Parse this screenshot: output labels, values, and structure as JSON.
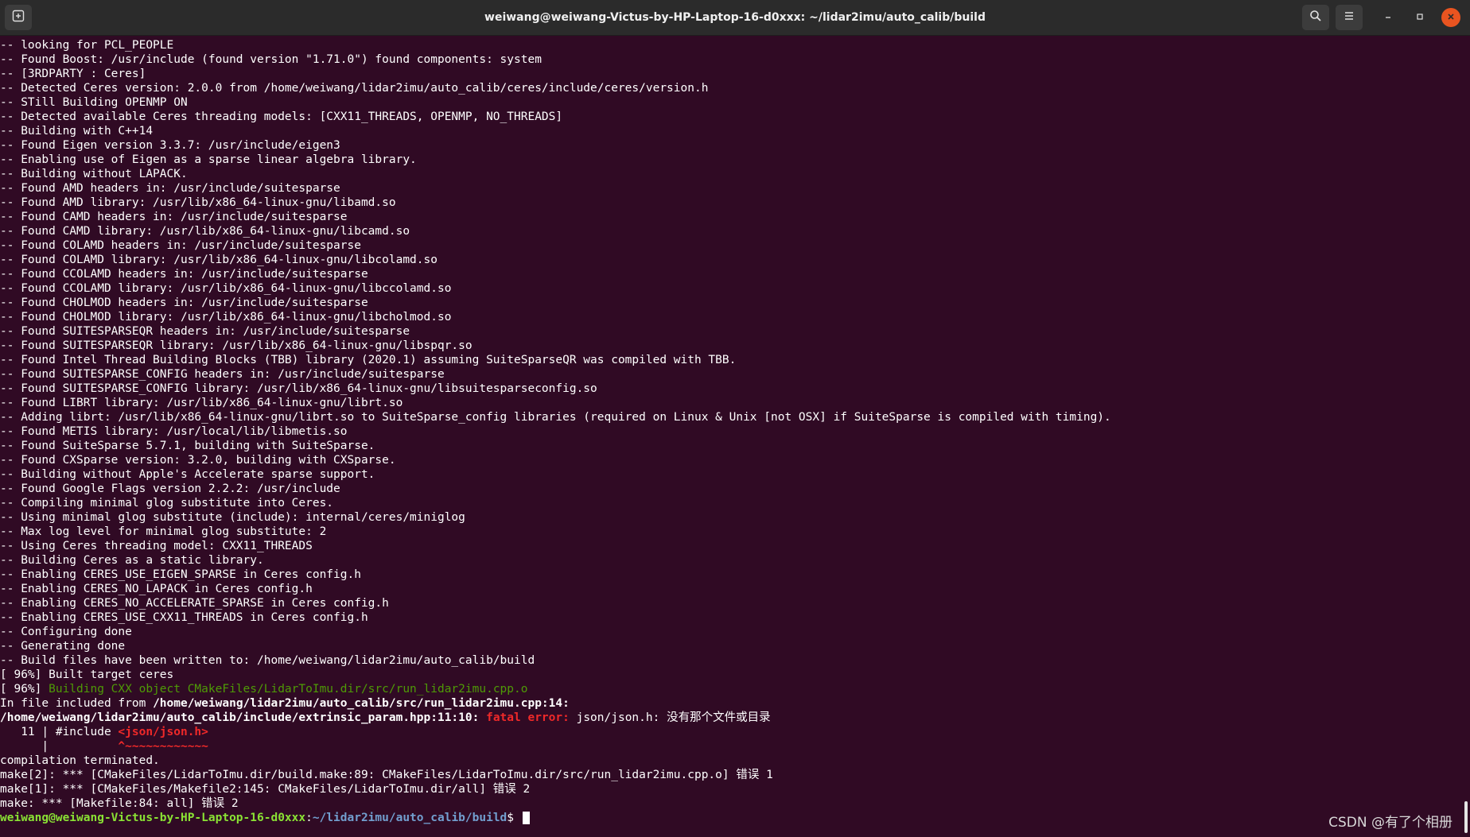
{
  "window": {
    "title": "weiwang@weiwang-Victus-by-HP-Laptop-16-d0xxx: ~/lidar2imu/auto_calib/build",
    "icons": {
      "new_tab": "new-tab-icon",
      "search": "search-icon",
      "menu": "hamburger-menu-icon",
      "minimize": "minimize-icon",
      "maximize": "maximize-icon",
      "close": "close-icon"
    },
    "accent_close": "#e95420",
    "background": "#300a24"
  },
  "terminal": {
    "lines": [
      [
        {
          "t": "-- looking for PCL_PEOPLE"
        }
      ],
      [
        {
          "t": "-- Found Boost: /usr/include (found version \"1.71.0\") found components: system"
        }
      ],
      [
        {
          "t": "-- [3RDPARTY : Ceres]"
        }
      ],
      [
        {
          "t": "-- Detected Ceres version: 2.0.0 from /home/weiwang/lidar2imu/auto_calib/ceres/include/ceres/version.h"
        }
      ],
      [
        {
          "t": "-- STill Building OPENMP ON"
        }
      ],
      [
        {
          "t": "-- Detected available Ceres threading models: [CXX11_THREADS, OPENMP, NO_THREADS]"
        }
      ],
      [
        {
          "t": "-- Building with C++14"
        }
      ],
      [
        {
          "t": "-- Found Eigen version 3.3.7: /usr/include/eigen3"
        }
      ],
      [
        {
          "t": "-- Enabling use of Eigen as a sparse linear algebra library."
        }
      ],
      [
        {
          "t": "-- Building without LAPACK."
        }
      ],
      [
        {
          "t": "-- Found AMD headers in: /usr/include/suitesparse"
        }
      ],
      [
        {
          "t": "-- Found AMD library: /usr/lib/x86_64-linux-gnu/libamd.so"
        }
      ],
      [
        {
          "t": "-- Found CAMD headers in: /usr/include/suitesparse"
        }
      ],
      [
        {
          "t": "-- Found CAMD library: /usr/lib/x86_64-linux-gnu/libcamd.so"
        }
      ],
      [
        {
          "t": "-- Found COLAMD headers in: /usr/include/suitesparse"
        }
      ],
      [
        {
          "t": "-- Found COLAMD library: /usr/lib/x86_64-linux-gnu/libcolamd.so"
        }
      ],
      [
        {
          "t": "-- Found CCOLAMD headers in: /usr/include/suitesparse"
        }
      ],
      [
        {
          "t": "-- Found CCOLAMD library: /usr/lib/x86_64-linux-gnu/libccolamd.so"
        }
      ],
      [
        {
          "t": "-- Found CHOLMOD headers in: /usr/include/suitesparse"
        }
      ],
      [
        {
          "t": "-- Found CHOLMOD library: /usr/lib/x86_64-linux-gnu/libcholmod.so"
        }
      ],
      [
        {
          "t": "-- Found SUITESPARSEQR headers in: /usr/include/suitesparse"
        }
      ],
      [
        {
          "t": "-- Found SUITESPARSEQR library: /usr/lib/x86_64-linux-gnu/libspqr.so"
        }
      ],
      [
        {
          "t": "-- Found Intel Thread Building Blocks (TBB) library (2020.1) assuming SuiteSparseQR was compiled with TBB."
        }
      ],
      [
        {
          "t": "-- Found SUITESPARSE_CONFIG headers in: /usr/include/suitesparse"
        }
      ],
      [
        {
          "t": "-- Found SUITESPARSE_CONFIG library: /usr/lib/x86_64-linux-gnu/libsuitesparseconfig.so"
        }
      ],
      [
        {
          "t": "-- Found LIBRT library: /usr/lib/x86_64-linux-gnu/librt.so"
        }
      ],
      [
        {
          "t": "-- Adding librt: /usr/lib/x86_64-linux-gnu/librt.so to SuiteSparse_config libraries (required on Linux & Unix [not OSX] if SuiteSparse is compiled with timing)."
        }
      ],
      [
        {
          "t": "-- Found METIS library: /usr/local/lib/libmetis.so"
        }
      ],
      [
        {
          "t": "-- Found SuiteSparse 5.7.1, building with SuiteSparse."
        }
      ],
      [
        {
          "t": "-- Found CXSparse version: 3.2.0, building with CXSparse."
        }
      ],
      [
        {
          "t": "-- Building without Apple's Accelerate sparse support."
        }
      ],
      [
        {
          "t": "-- Found Google Flags version 2.2.2: /usr/include"
        }
      ],
      [
        {
          "t": "-- Compiling minimal glog substitute into Ceres."
        }
      ],
      [
        {
          "t": "-- Using minimal glog substitute (include): internal/ceres/miniglog"
        }
      ],
      [
        {
          "t": "-- Max log level for minimal glog substitute: 2"
        }
      ],
      [
        {
          "t": "-- Using Ceres threading model: CXX11_THREADS"
        }
      ],
      [
        {
          "t": "-- Building Ceres as a static library."
        }
      ],
      [
        {
          "t": "-- Enabling CERES_USE_EIGEN_SPARSE in Ceres config.h"
        }
      ],
      [
        {
          "t": "-- Enabling CERES_NO_LAPACK in Ceres config.h"
        }
      ],
      [
        {
          "t": "-- Enabling CERES_NO_ACCELERATE_SPARSE in Ceres config.h"
        }
      ],
      [
        {
          "t": "-- Enabling CERES_USE_CXX11_THREADS in Ceres config.h"
        }
      ],
      [
        {
          "t": "-- Configuring done"
        }
      ],
      [
        {
          "t": "-- Generating done"
        }
      ],
      [
        {
          "t": "-- Build files have been written to: /home/weiwang/lidar2imu/auto_calib/build"
        }
      ],
      [
        {
          "t": "[ 96%] Built target ceres"
        }
      ],
      [
        {
          "t": "[ 96%] "
        },
        {
          "t": "Building CXX object CMakeFiles/LidarToImu.dir/src/run_lidar2imu.cpp.o",
          "c": "green"
        }
      ],
      [
        {
          "t": "In file included from "
        },
        {
          "t": "/home/weiwang/lidar2imu/auto_calib/src/run_lidar2imu.cpp:14",
          "c": "bold"
        },
        {
          "t": ":",
          "c": "bold"
        }
      ],
      [
        {
          "t": "/home/weiwang/lidar2imu/auto_calib/include/extrinsic_param.hpp:11:10:",
          "c": "bold"
        },
        {
          "t": " "
        },
        {
          "t": "fatal error:",
          "c": "redb"
        },
        {
          "t": " json/json.h: 没有那个文件或目录"
        }
      ],
      [
        {
          "t": "   11 | #include "
        },
        {
          "t": "<json/json.h>",
          "c": "redb"
        }
      ],
      [
        {
          "t": "      |          "
        },
        {
          "t": "^~~~~~~~~~~~~",
          "c": "redb"
        }
      ],
      [
        {
          "t": "compilation terminated."
        }
      ],
      [
        {
          "t": "make[2]: *** [CMakeFiles/LidarToImu.dir/build.make:89: CMakeFiles/LidarToImu.dir/src/run_lidar2imu.cpp.o] 错误 1"
        }
      ],
      [
        {
          "t": "make[1]: *** [CMakeFiles/Makefile2:145: CMakeFiles/LidarToImu.dir/all] 错误 2"
        }
      ],
      [
        {
          "t": "make: *** [Makefile:84: all] 错误 2"
        }
      ],
      [
        {
          "t": "weiwang@weiwang-Victus-by-HP-Laptop-16-d0xxx",
          "c": "greenb"
        },
        {
          "t": ":"
        },
        {
          "t": "~/lidar2imu/auto_calib/build",
          "c": "blueb"
        },
        {
          "t": "$ "
        }
      ]
    ]
  },
  "watermark": "CSDN @有了个相册"
}
